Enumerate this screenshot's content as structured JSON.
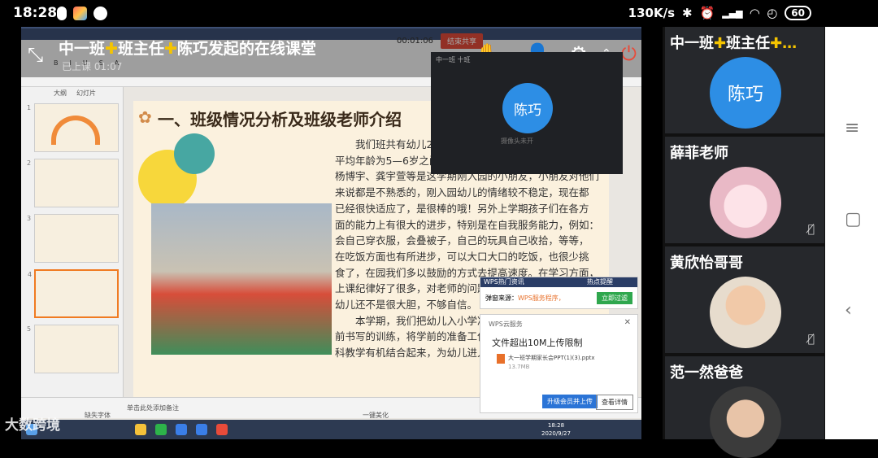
{
  "status_bar": {
    "time": "18:28",
    "network_speed": "130K/s",
    "battery": "60"
  },
  "lesson": {
    "title_part1": "中一班",
    "title_cross": "✚",
    "title_part2": "班主任",
    "title_part3": "陈巧发起的在线课堂",
    "subtitle": "已上课 01:07",
    "timer": "00:01:06",
    "end_button": "结束共享"
  },
  "slide_panel": {
    "tab_outline": "大纲",
    "tab_slides": "幻灯片",
    "numbers": [
      "1",
      "2",
      "3",
      "4",
      "5"
    ]
  },
  "slide": {
    "title": "一、班级情况分析及班级老师介绍",
    "body": "　　我们班共有幼儿28名，\n平均年龄为5—6岁之间，\n杨博宇、龚宇萱等是这学期刚入园的小朋友，小朋友对他们\n来说都是不熟悉的，刚入园幼儿的情绪较不稳定，现在都\n已经很快适应了，是很棒的哦！另外上学期孩子们在各方\n面的能力上有很大的进步，特别是在自我服务能力，例如：\n会自己穿衣服，会叠被子，自己的玩具自己收拾，等等，\n在吃饭方面也有所进步，可以大口大口的吃饭，也很少挑\n食了，在园我们多以鼓励的方式去提高速度。在学习方面，\n上课纪律好了很多，对老师的问题能积极的回答，但也有\n幼儿还不是很大胆，不够自信。\n　　本学期，我们把幼儿入小学准备工作做细做实，一些\n前书写的训练，将学前的准备工作\n科教学有机结合起来，为幼儿进入"
  },
  "status_bottom": {
    "note": "单击此处添加备注",
    "font": "缺失字体",
    "beautify": "一键美化"
  },
  "preview": {
    "caption": "中一班 十班",
    "avatar_name": "陈巧",
    "status": "摄像头未开"
  },
  "popup_ad": {
    "header": "WPS热门资讯",
    "header_right": "热点提醒",
    "source": "弹窗来源：",
    "source_app": "WPS服务程序，",
    "button": "立即过滤"
  },
  "popup_cloud": {
    "header": "WPS云服务",
    "title": "文件超出10M上传限制",
    "file_name": "大一班学期家长会PPT(1)(3).pptx",
    "file_size": "13.7MB",
    "upgrade_button": "升级会员并上传",
    "detail_button": "查看详情"
  },
  "taskbar": {
    "clock_time": "18:28",
    "clock_date": "2020/9/27"
  },
  "watermark": "大数跨境",
  "participants": [
    {
      "name_part1": "中一班",
      "cross": "✚",
      "name_part2": "班主任",
      "name_part3": "✚…",
      "avatar_text": "陈巧",
      "avatar_color": "#2d8ee5"
    },
    {
      "name": "薛菲老师"
    },
    {
      "name": "黄欣怡哥哥"
    },
    {
      "name": "范一然爸爸"
    }
  ],
  "colors": {
    "accent_yellow": "#f5c400",
    "host_avatar": "#2d8ee5"
  }
}
